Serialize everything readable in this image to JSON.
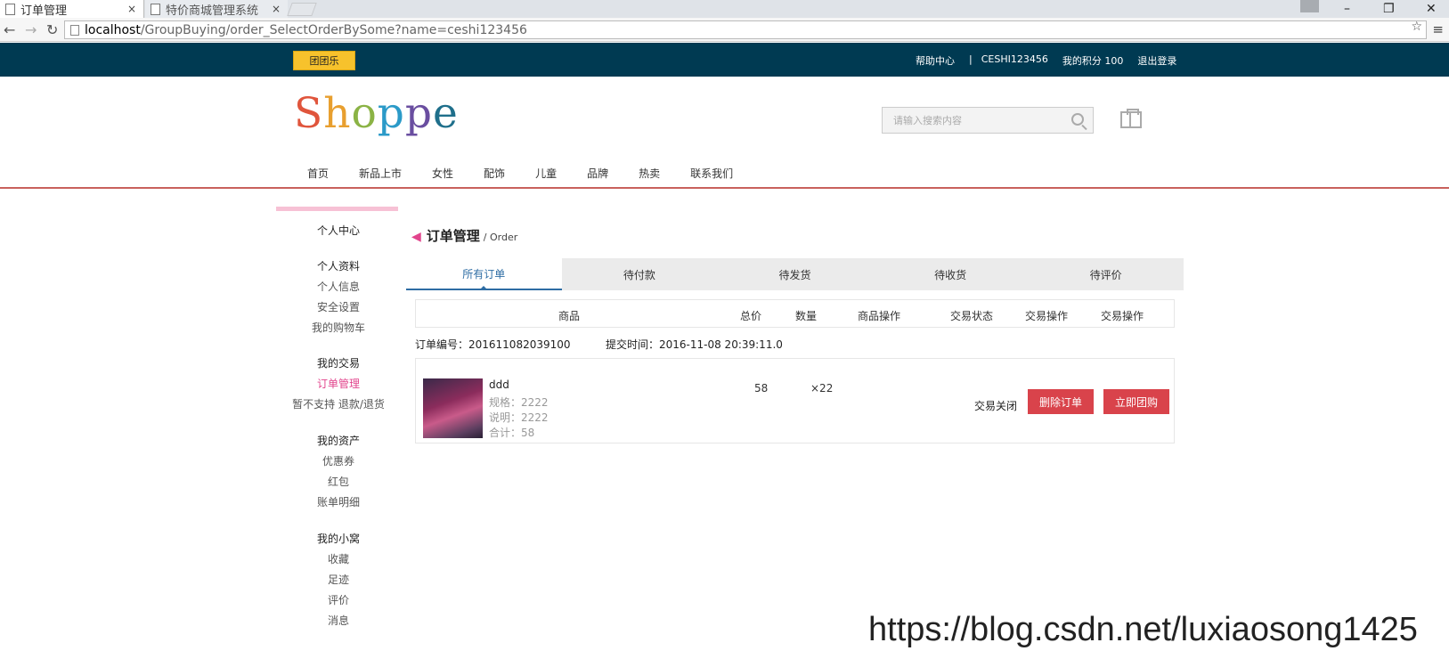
{
  "browser": {
    "tabs": [
      {
        "label": "订单管理",
        "close": "×"
      },
      {
        "label": "特价商城管理系统",
        "close": "×"
      }
    ],
    "url": {
      "host": "localhost",
      "path": "/GroupBuying/order_SelectOrderBySome?name=ceshi123456"
    },
    "window_controls": [
      "–",
      "❐",
      "✕"
    ]
  },
  "topbar": {
    "logo_button": "团团乐",
    "links": [
      "帮助中心",
      "|",
      "CESHI123456",
      "我的积分 100",
      "退出登录"
    ]
  },
  "header": {
    "brand_letters": [
      "S",
      "h",
      "o",
      "p",
      "p",
      "e"
    ],
    "brand_colors": [
      "#e0553c",
      "#e89f2f",
      "#8bb345",
      "#2b9ac8",
      "#6a4ea0",
      "#1f6f8b"
    ],
    "search_placeholder": "请输入搜索内容"
  },
  "main_nav": [
    "首页",
    "新品上市",
    "女性",
    "配饰",
    "儿童",
    "品牌",
    "热卖",
    "联系我们"
  ],
  "sidebar": {
    "title": "个人中心",
    "groups": [
      {
        "head": "个人资料",
        "items": [
          "个人信息",
          "安全设置",
          "我的购物车"
        ]
      },
      {
        "head": "我的交易",
        "items": [
          "订单管理",
          "暂不支持 退款/退货"
        ]
      },
      {
        "head": "我的资产",
        "items": [
          "优惠券",
          "红包",
          "账单明细"
        ]
      },
      {
        "head": "我的小窝",
        "items": [
          "收藏",
          "足迹",
          "评价",
          "消息"
        ]
      }
    ],
    "active_item": "订单管理"
  },
  "content": {
    "title": "订单管理",
    "subtitle": "/ Order",
    "tabs": [
      "所有订单",
      "待付款",
      "待发货",
      "待收货",
      "待评价"
    ],
    "columns": [
      "商品",
      "总价",
      "数量",
      "商品操作",
      "交易状态",
      "交易操作",
      "交易操作"
    ],
    "order": {
      "number_label": "订单编号：201611082039100",
      "time_label": "提交时间：2016-11-08 20:39:11.0",
      "product": "ddd",
      "spec": "规格：2222",
      "desc": "说明：2222",
      "total": "合计：58",
      "price": "58",
      "qty": "×22",
      "status": "交易关闭",
      "delete_button": "删除订单",
      "buy_button": "立即团购"
    }
  },
  "watermark": "https://blog.csdn.net/luxiaosong1425"
}
